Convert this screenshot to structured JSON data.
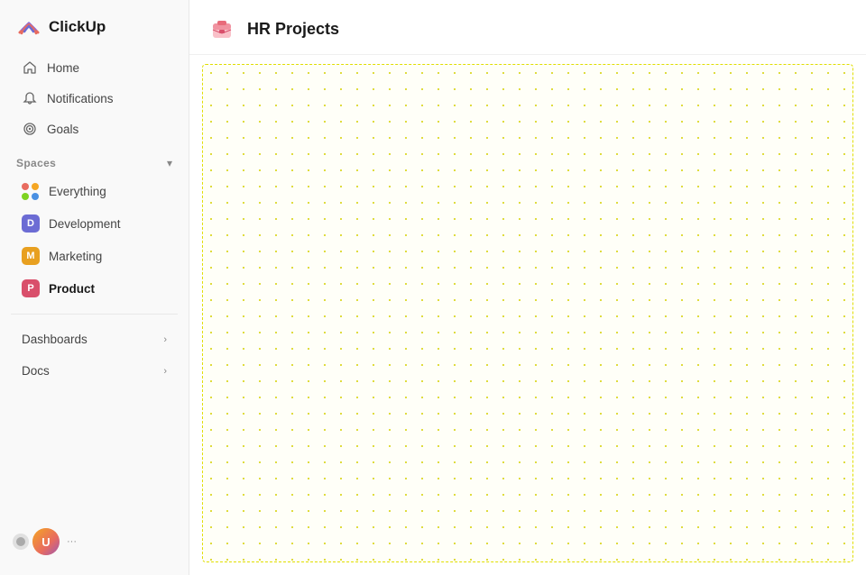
{
  "app": {
    "name": "ClickUp"
  },
  "sidebar": {
    "nav": [
      {
        "id": "home",
        "label": "Home",
        "icon": "home"
      },
      {
        "id": "notifications",
        "label": "Notifications",
        "icon": "bell"
      },
      {
        "id": "goals",
        "label": "Goals",
        "icon": "target"
      }
    ],
    "spaces": {
      "label": "Spaces",
      "chevron": "▾",
      "items": [
        {
          "id": "everything",
          "label": "Everything",
          "type": "dots"
        },
        {
          "id": "development",
          "label": "Development",
          "type": "letter",
          "letter": "D",
          "color": "#6c6cd4"
        },
        {
          "id": "marketing",
          "label": "Marketing",
          "type": "letter",
          "letter": "M",
          "color": "#e8a020"
        },
        {
          "id": "product",
          "label": "Product",
          "type": "letter",
          "letter": "P",
          "color": "#d94f6b",
          "active": true
        }
      ]
    },
    "expandable": [
      {
        "id": "dashboards",
        "label": "Dashboards"
      },
      {
        "id": "docs",
        "label": "Docs"
      }
    ],
    "user": {
      "initials": "U",
      "chevron": "..."
    }
  },
  "main": {
    "header": {
      "title": "HR Projects"
    }
  }
}
